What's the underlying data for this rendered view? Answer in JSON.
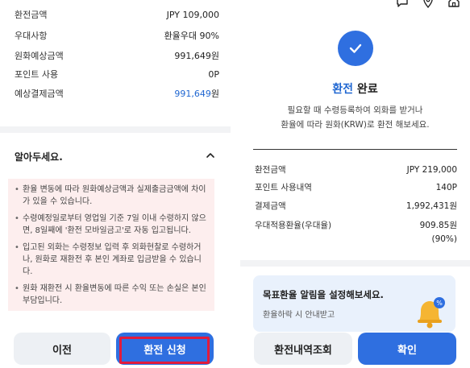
{
  "left": {
    "summary": [
      {
        "label": "환전금액",
        "value": "JPY 109,000"
      },
      {
        "label": "우대사항",
        "value": "환율우대 90%"
      },
      {
        "label": "원화예상금액",
        "value": "991,649원"
      },
      {
        "label": "포인트 사용",
        "value": "0P"
      },
      {
        "label": "예상결제금액",
        "value_number": "991,649",
        "value_unit": "원"
      }
    ],
    "notice": {
      "title": "알아두세요.",
      "items": [
        "환율 변동에 따라 원화예상금액과 실제출금금액에 차이가 있을 수 있습니다.",
        "수령예정일로부터 영업일 기준 7일 이내 수령하지 않으면, 8일째에 '환전 모바일금고'로 자동 입고됩니다.",
        "입고된 외화는 수령정보 입력 후 외화현찰로 수령하거나, 원화로 재환전 후 본인 계좌로 입금받을 수 있습니다.",
        "원화 재환전 시 환율변동에 따른 수익 또는 손실은 본인 부담입니다."
      ]
    },
    "buttons": {
      "prev": "이전",
      "apply": "환전 신청"
    }
  },
  "right": {
    "done_title_accent": "환전",
    "done_title_rest": " 완료",
    "done_desc_line1": "필요할 때 수령등록하여 외화를 받거나",
    "done_desc_line2": "환율에 따라 원화(KRW)로 환전 해보세요.",
    "result": [
      {
        "label": "환전금액",
        "value": "JPY 219,000"
      },
      {
        "label": "포인트 사용내역",
        "value": "140P"
      },
      {
        "label": "결제금액",
        "value": "1,992,431원"
      },
      {
        "label": "우대적용환율(우대율)",
        "value": "909.85원",
        "value2": "(90%)"
      }
    ],
    "alert": {
      "title": "목표환율 알림을 설정해보세요.",
      "sub": "환율하락 시 안내받고"
    },
    "buttons": {
      "history": "환전내역조회",
      "confirm": "확인"
    }
  },
  "icons": [
    "chat-icon",
    "location-icon",
    "home-icon",
    "check-icon",
    "chevron-up-icon",
    "bell-icon"
  ],
  "colors": {
    "accent": "#2f6fe0",
    "text_accent": "#1f66d1",
    "notice_bg": "#fdeeee",
    "highlight": "#e21b3c",
    "gray_button": "#edf0f4"
  }
}
